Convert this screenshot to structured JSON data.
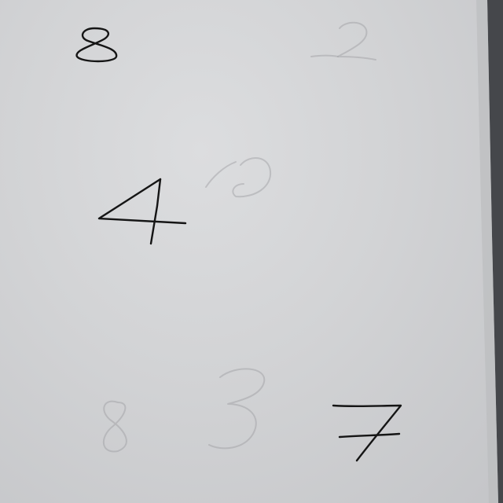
{
  "scene": {
    "description_kind": "photo of paper with handwritten digits",
    "paper_color": "#d6d7d9",
    "ink_color": "#151515",
    "ghost_color": "#9b9c9f",
    "edge_color": "#4a4c50"
  },
  "digits": [
    {
      "id": "digit-8-top",
      "value": "8",
      "style": "ink"
    },
    {
      "id": "digit-4",
      "value": "4",
      "style": "ink"
    },
    {
      "id": "digit-7",
      "value": "7",
      "style": "ink"
    }
  ],
  "ghost_digits": [
    {
      "id": "ghost-2-top-right",
      "value": "2"
    },
    {
      "id": "ghost-2-middle",
      "value": "2"
    },
    {
      "id": "ghost-8-bottom",
      "value": "8"
    },
    {
      "id": "ghost-3-bottom",
      "value": "3"
    }
  ]
}
